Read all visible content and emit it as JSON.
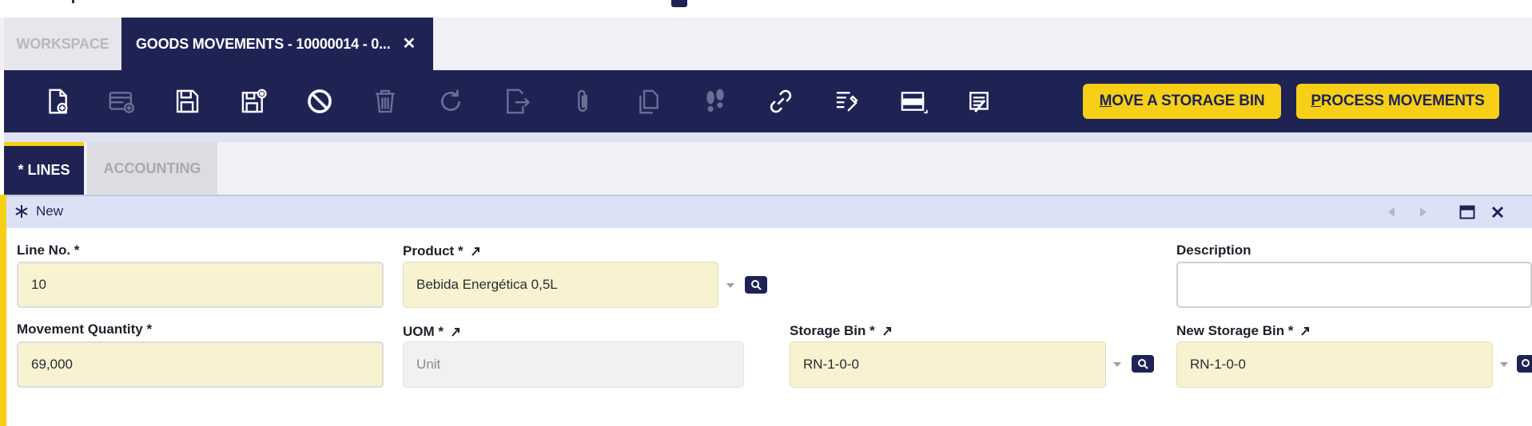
{
  "window": {
    "tabs": [
      {
        "label": "WORKSPACE",
        "active": false
      },
      {
        "label": "GOODS MOVEMENTS - 10000014 - 0...",
        "active": true
      }
    ]
  },
  "toolbar": {
    "icons": [
      "new-document-icon",
      "new-row-icon",
      "save-icon",
      "save-close-icon",
      "undo-icon",
      "delete-icon",
      "refresh-icon",
      "export-icon",
      "attachment-icon",
      "copy-icon",
      "audit-trail-icon",
      "link-icon",
      "customize-icon",
      "grid-form-toggle-icon",
      "notes-icon"
    ],
    "actions": {
      "move_bin": {
        "accel": "M",
        "rest": "OVE A STORAGE BIN"
      },
      "process": {
        "accel": "P",
        "rest": "ROCESS MOVEMENTS"
      }
    }
  },
  "subtabs": [
    {
      "label": "* LINES",
      "active": true
    },
    {
      "label": "ACCOUNTING",
      "active": false
    }
  ],
  "formbar": {
    "status": "New"
  },
  "form": {
    "line_no": {
      "label": "Line No. *",
      "value": "10"
    },
    "product": {
      "label": "Product *",
      "value": "Bebida Energética 0,5L"
    },
    "description": {
      "label": "Description",
      "value": ""
    },
    "movement_qty": {
      "label": "Movement Quantity *",
      "value": "69,000"
    },
    "uom": {
      "label": "UOM *",
      "value": "Unit"
    },
    "storage_bin": {
      "label": "Storage Bin *",
      "value": "RN-1-0-0"
    },
    "new_storage_bin": {
      "label": "New Storage Bin *",
      "value": "RN-1-0-0"
    }
  },
  "colors": {
    "navy": "#1f2354",
    "accent_yellow": "#f7cf17",
    "required_field": "#f8f2d0"
  }
}
